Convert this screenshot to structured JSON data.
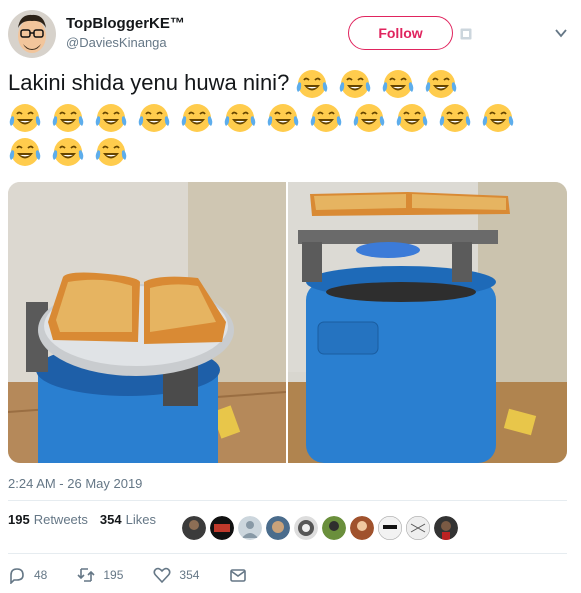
{
  "user": {
    "display_name": "TopBloggerKE™",
    "handle": "@DaviesKinanga"
  },
  "follow_label": "Follow",
  "tweet": {
    "text": "Lakini shida yenu huwa nini?",
    "emoji": "face-with-tears-of-joy",
    "emoji_count": 19
  },
  "timestamp": "2:24 AM - 26 May 2019",
  "stats": {
    "retweets_count": "195",
    "retweets_label": "Retweets",
    "likes_count": "354",
    "likes_label": "Likes"
  },
  "actions": {
    "replies": "48",
    "retweets": "195",
    "likes": "354"
  },
  "colors": {
    "accent": "#e0245e",
    "muted": "#657786",
    "cylinder_blue": "#2a7fd0",
    "toast": "#e0a64a"
  }
}
